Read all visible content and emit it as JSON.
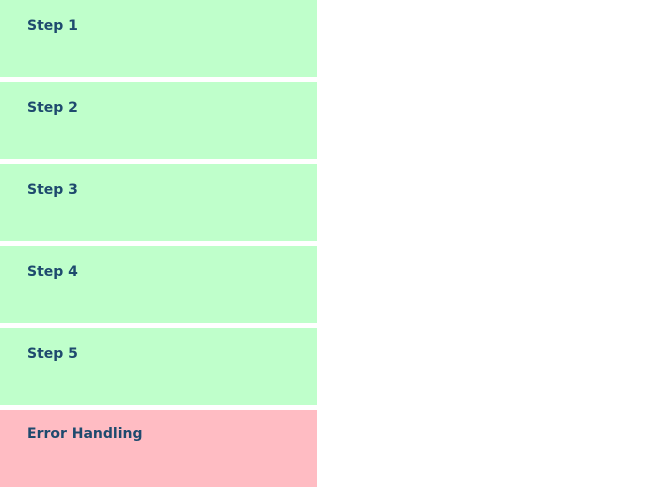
{
  "colors": {
    "step_fill": "#bfffcb",
    "error_fill": "#ffbcc3",
    "label_text": "#1e4a6e",
    "background": "#ffffff"
  },
  "blocks": [
    {
      "label": "Step 1",
      "kind": "step"
    },
    {
      "label": "Step 2",
      "kind": "step"
    },
    {
      "label": "Step 3",
      "kind": "step"
    },
    {
      "label": "Step 4",
      "kind": "step"
    },
    {
      "label": "Step 5",
      "kind": "step"
    },
    {
      "label": "Error Handling",
      "kind": "error"
    }
  ]
}
